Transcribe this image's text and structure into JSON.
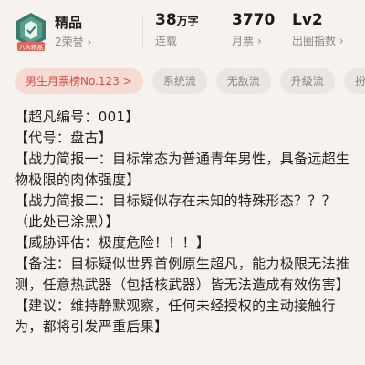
{
  "header": {
    "badge": {
      "title": "精品",
      "subtitle": "2荣誉",
      "chevron": "›",
      "ribbon_text": "八大精品",
      "icon": "honor-badge-icon"
    },
    "stats": [
      {
        "value": "38",
        "unit": "万字",
        "label": "连载"
      },
      {
        "value": "3770",
        "unit": "",
        "label": "月票",
        "chevron": "›"
      },
      {
        "value": "Lv2",
        "unit": "",
        "label": "出圈指数",
        "chevron": "›"
      }
    ]
  },
  "tags": {
    "rank": "男生月票榜No.123 >",
    "items": [
      "系统流",
      "无敌流",
      "升级流",
      "扮"
    ]
  },
  "content": {
    "lines": [
      "【超凡编号：001】",
      "【代号：盘古】",
      "【战力简报一：目标常态为普通青年男性，具备远超生物极限的肉体强度】",
      "【战力简报二：目标疑似存在未知的特殊形态？？？（此处已涂黑）】",
      "【威胁评估：极度危险！！！】",
      "【备注：目标疑似世界首例原生超凡，能力极限无法推测，任意热武器（包括核武器）皆无法造成有效伤害】",
      "【建议：维持静默观察，任何未经授权的主动接触行为，都将引发严重后果】"
    ]
  },
  "colors": {
    "background": "#f7f2ee",
    "rank_tag_bg": "#f6dad4",
    "rank_tag_text": "#d24c41",
    "tag_bg": "#ebe6e2",
    "badge_green": "#3b7b6c"
  }
}
